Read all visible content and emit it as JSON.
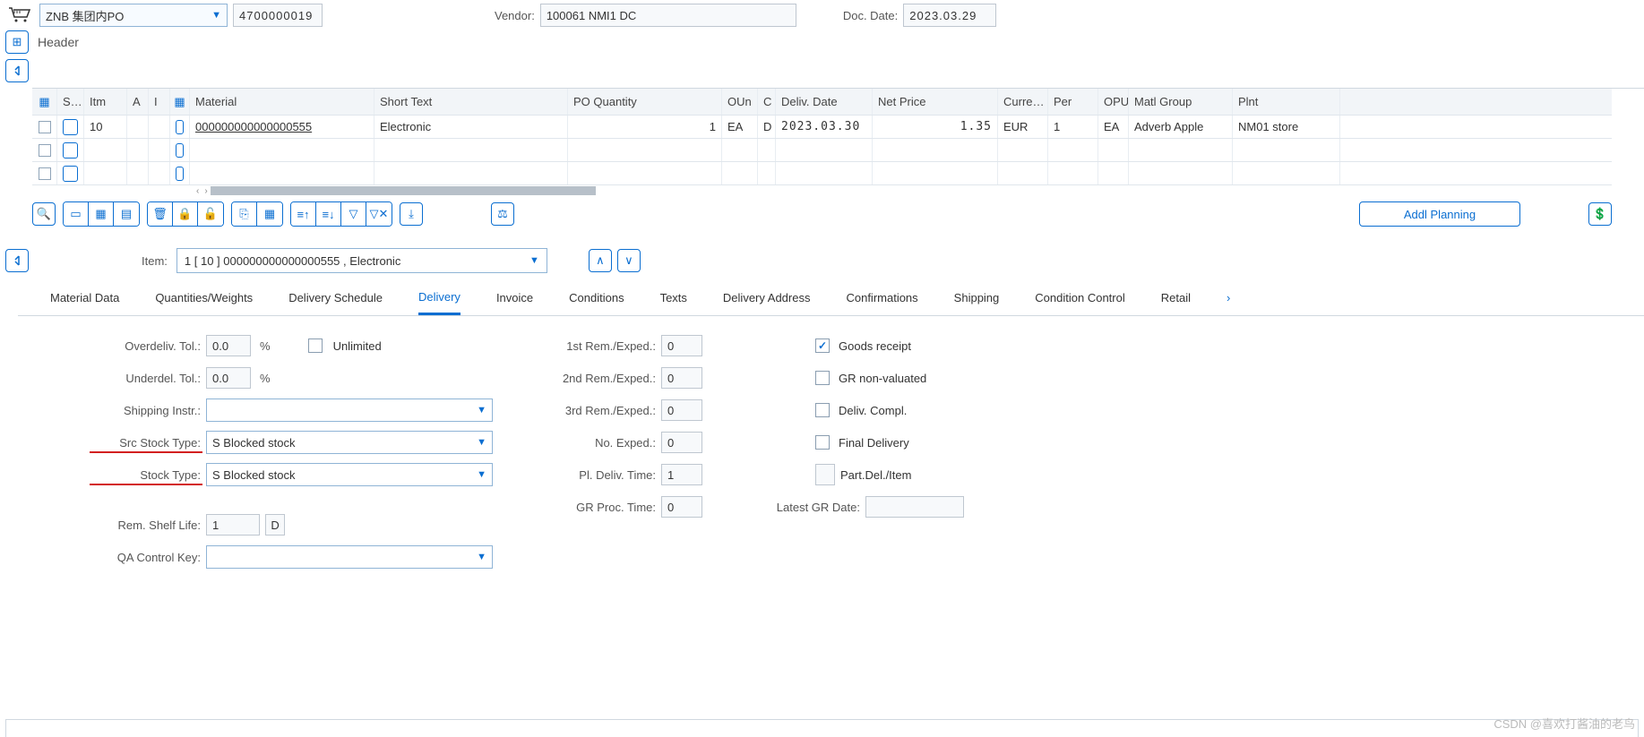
{
  "header": {
    "doc_type": "ZNB 集团内PO",
    "po_number": "4700000019",
    "vendor_label": "Vendor:",
    "vendor": "100061 NMI1 DC",
    "doc_date_label": "Doc. Date:",
    "doc_date": "2023.03.29",
    "header_text": "Header"
  },
  "table": {
    "cols": {
      "s": "S…",
      "itm": "Itm",
      "a": "A",
      "i": "I",
      "material": "Material",
      "short": "Short Text",
      "poq": "PO Quantity",
      "oun": "OUn",
      "c": "C",
      "deliv": "Deliv. Date",
      "netp": "Net Price",
      "curr": "Curre…",
      "per": "Per",
      "opu": "OPU",
      "matg": "Matl Group",
      "plnt": "Plnt"
    },
    "rows": [
      {
        "itm": "10",
        "material": "000000000000000555",
        "short": "Electronic",
        "poq": "1",
        "oun": "EA",
        "c": "D",
        "deliv": "2023.03.30",
        "netp": "1.35",
        "curr": "EUR",
        "per": "1",
        "opu": "EA",
        "matg": "Adverb Apple",
        "plnt": "NM01 store"
      }
    ]
  },
  "toolbar": {
    "addl_planning": "Addl Planning"
  },
  "item_sel": {
    "label": "Item:",
    "value": "1 [ 10 ] 000000000000000555 , Electronic"
  },
  "tabs": [
    "Material Data",
    "Quantities/Weights",
    "Delivery Schedule",
    "Delivery",
    "Invoice",
    "Conditions",
    "Texts",
    "Delivery Address",
    "Confirmations",
    "Shipping",
    "Condition Control",
    "Retail"
  ],
  "form": {
    "overdeliv_label": "Overdeliv. Tol.:",
    "overdeliv": "0.0",
    "pct": "%",
    "unlimited_label": "Unlimited",
    "underdel_label": "Underdel. Tol.:",
    "underdel": "0.0",
    "shipping_label": "Shipping Instr.:",
    "shipping": "",
    "src_stock_label": "Src Stock Type:",
    "src_stock": "S Blocked stock",
    "stock_label": "Stock Type:",
    "stock": "S Blocked stock",
    "rem_shelf_label": "Rem. Shelf Life:",
    "rem_shelf": "1",
    "rem_shelf_u": "D",
    "qa_label": "QA Control Key:",
    "rem1_label": "1st Rem./Exped.:",
    "rem1": "0",
    "rem2_label": "2nd Rem./Exped.:",
    "rem2": "0",
    "rem3_label": "3rd Rem./Exped.:",
    "rem3": "0",
    "noexp_label": "No. Exped.:",
    "noexp": "0",
    "pldeliv_label": "Pl. Deliv. Time:",
    "pldeliv": "1",
    "grproc_label": "GR Proc. Time:",
    "grproc": "0",
    "goods_receipt": "Goods receipt",
    "gr_nonval": "GR non-valuated",
    "deliv_compl": "Deliv. Compl.",
    "final_deliv": "Final Delivery",
    "part_del": "Part.Del./Item",
    "latest_gr_label": "Latest GR Date:"
  },
  "watermark": "CSDN @喜欢打酱油的老鸟"
}
